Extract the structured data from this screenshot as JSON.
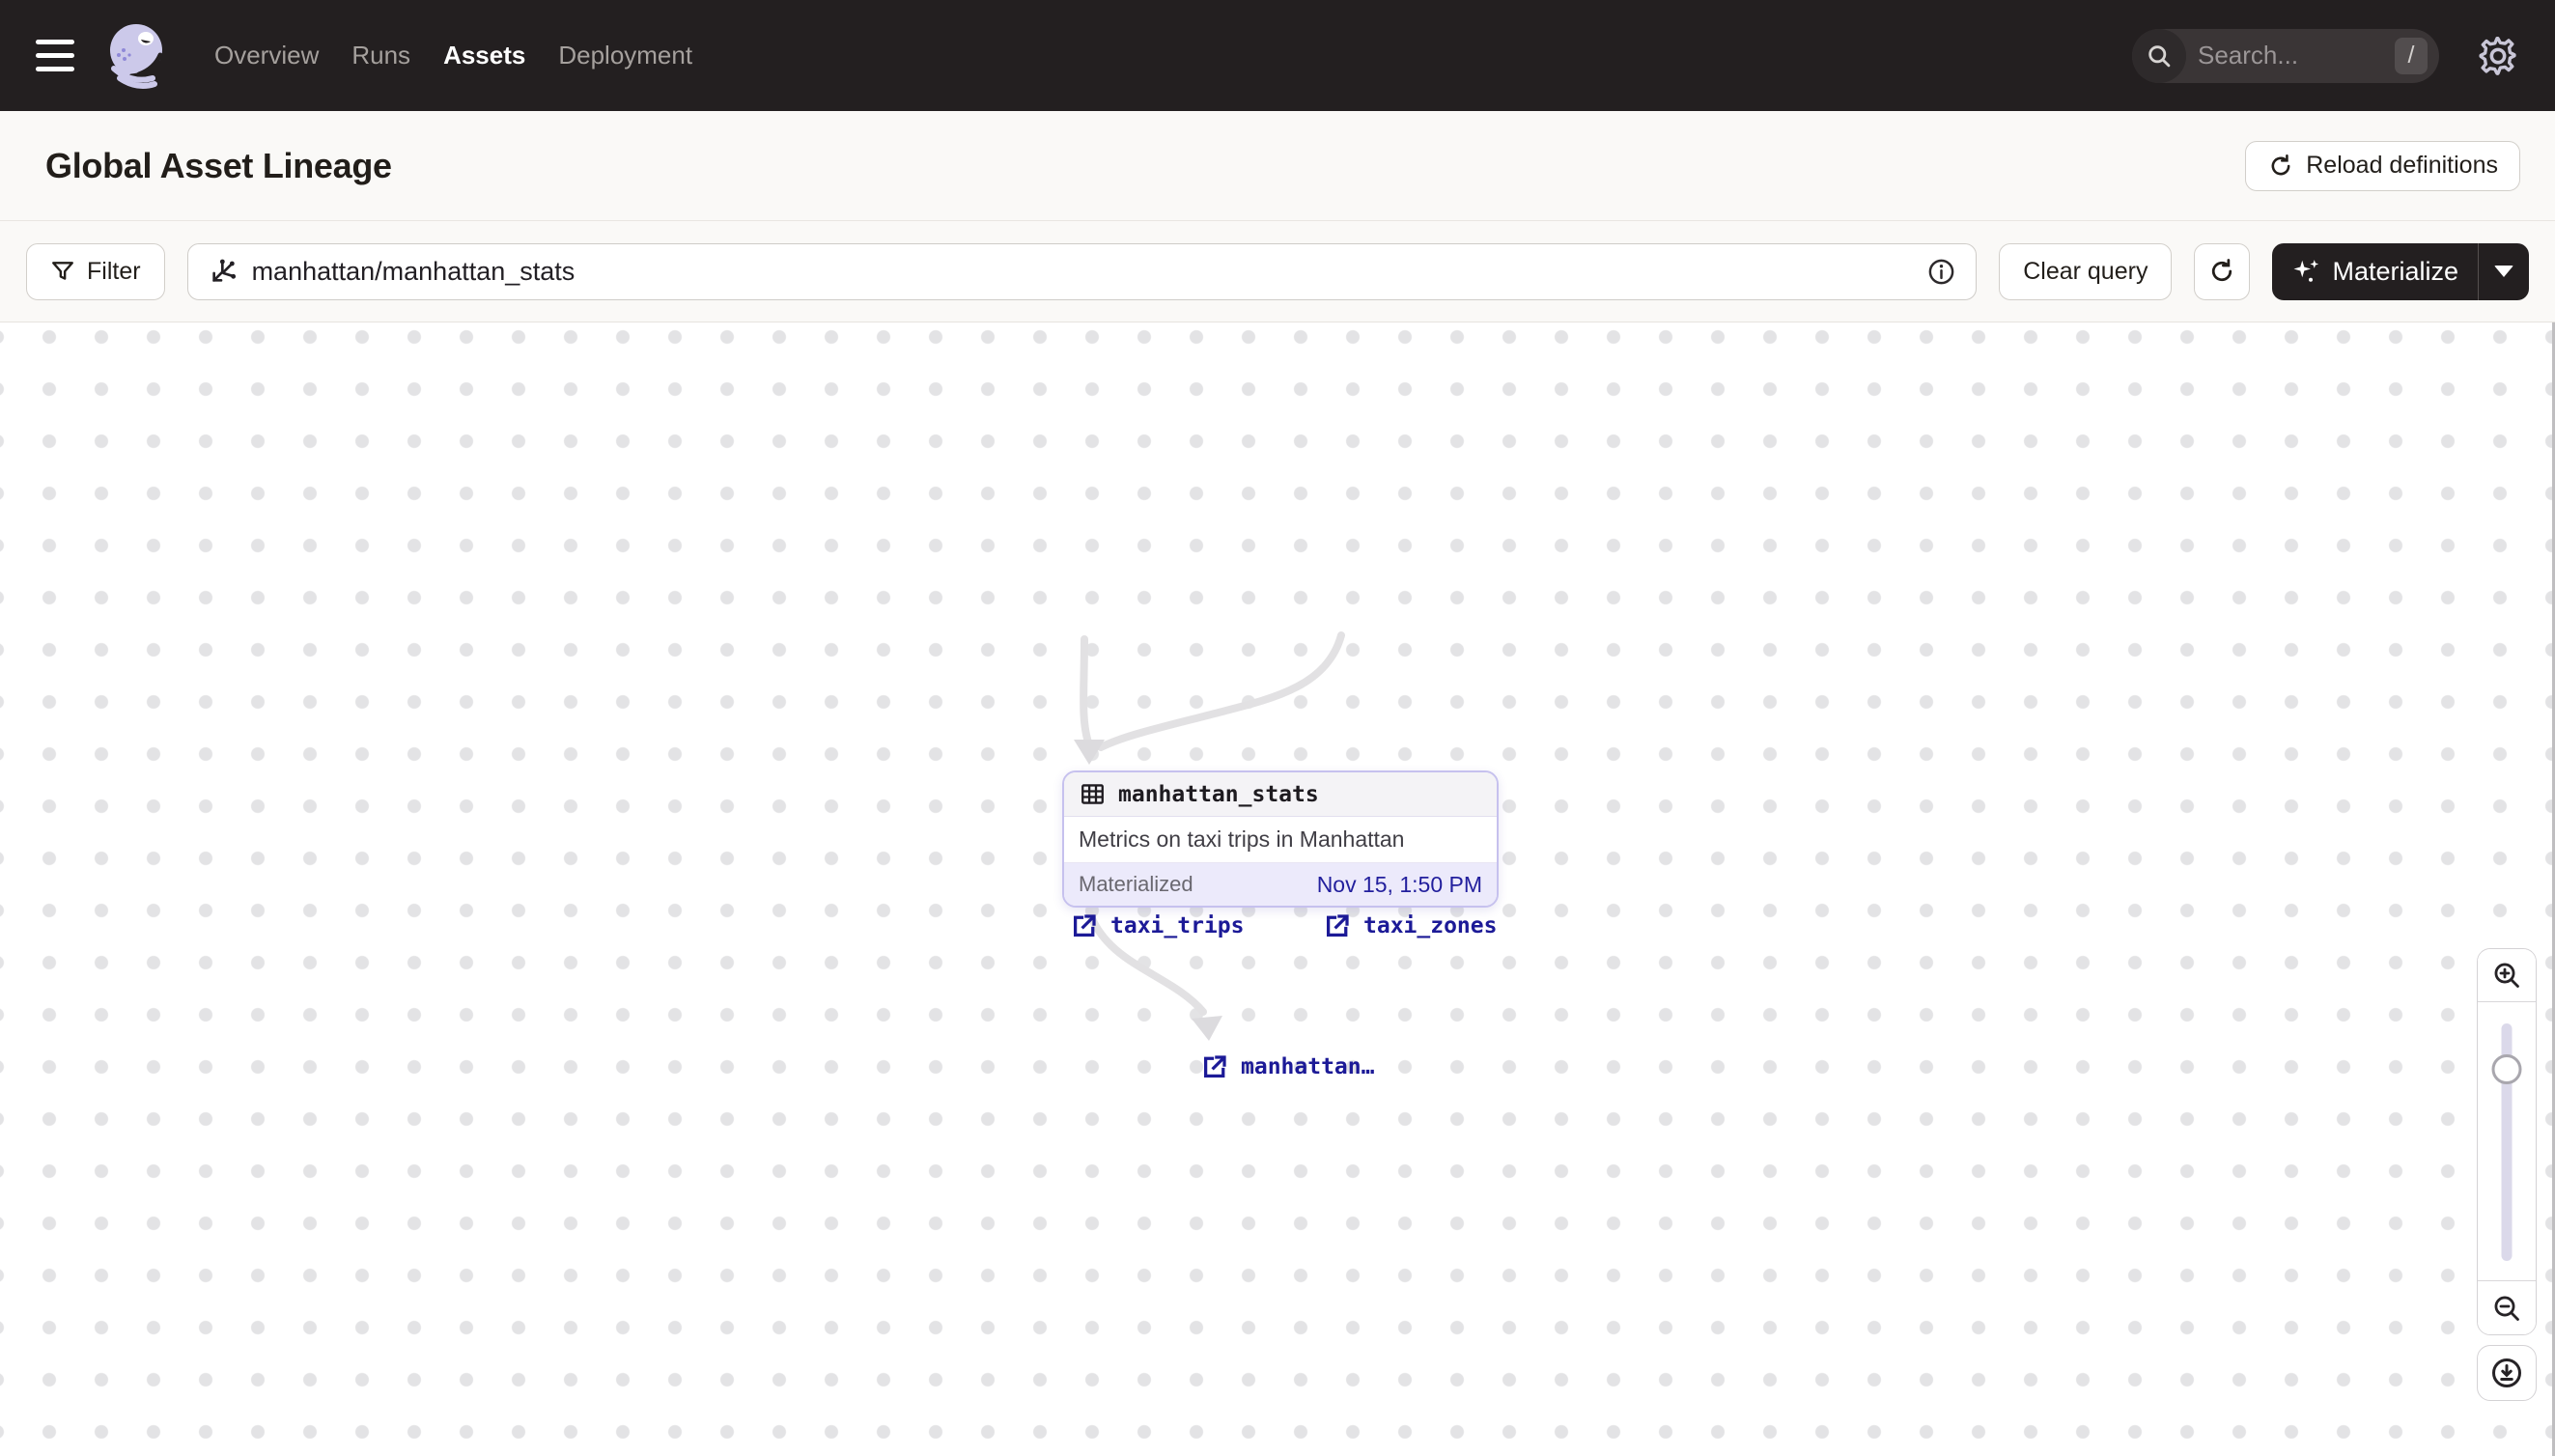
{
  "nav": {
    "menu": [
      {
        "label": "Overview"
      },
      {
        "label": "Runs"
      },
      {
        "label": "Assets"
      },
      {
        "label": "Deployment"
      }
    ],
    "active_item": "Assets",
    "search_placeholder": "Search...",
    "search_shortcut": "/"
  },
  "page": {
    "title": "Global Asset Lineage",
    "reload_button": "Reload definitions"
  },
  "toolbar": {
    "filter_label": "Filter",
    "query_value": "manhattan/manhattan_stats",
    "clear_label": "Clear query",
    "materialize_label": "Materialize"
  },
  "graph": {
    "upstream_assets": [
      {
        "label": "taxi_trips"
      },
      {
        "label": "taxi_zones"
      }
    ],
    "selected_asset": {
      "name": "manhattan_stats",
      "description": "Metrics on taxi trips in Manhattan",
      "status": "Materialized",
      "materialized_at": "Nov 15, 1:50 PM"
    },
    "downstream_assets": [
      {
        "label": "manhattan…"
      }
    ]
  },
  "icons": {
    "hamburger-icon": "three horizontal bars",
    "dagster-logo": "lavender octopus mark",
    "search-icon": "magnifier",
    "slash-shortcut": "/",
    "gear-icon": "settings gear",
    "refresh-icon": "circular arrow",
    "filter-icon": "funnel",
    "asset-graph-icon": "branching selector asterisk",
    "info-icon": "circled i",
    "sparkle-icon": "four-point stars",
    "caret-down-icon": "filled triangle",
    "external-link-icon": "box with outgoing arrow",
    "table-icon": "grid table",
    "zoom-in-icon": "magnifier with plus",
    "zoom-out-icon": "magnifier with minus",
    "recenter-download-icon": "circled arrow down to line"
  },
  "colors": {
    "nav_bg": "#231f20",
    "page_bg": "#faf9f7",
    "accent_lavender": "#c6c1ee",
    "link_navy": "#1c1a97",
    "edge_gray": "#e2e1e3",
    "status_time_navy": "#221f9d"
  }
}
